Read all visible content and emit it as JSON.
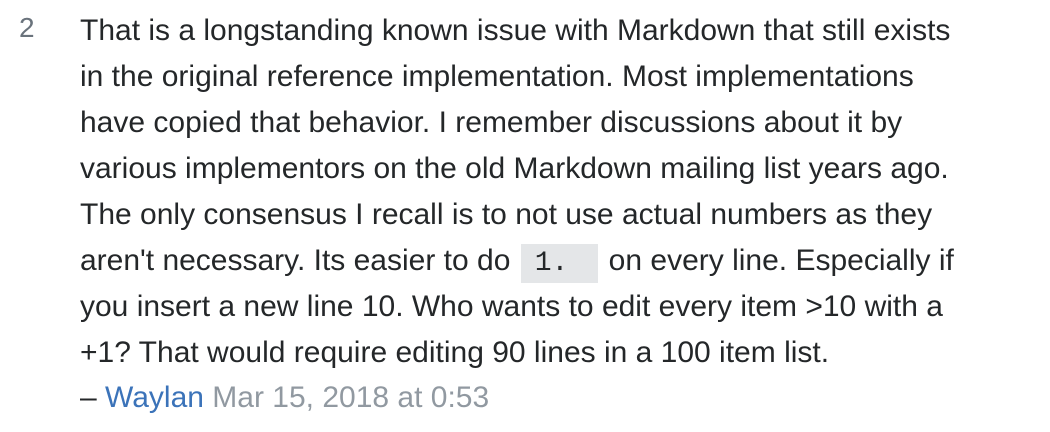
{
  "comment": {
    "score": "2",
    "lines": [
      "That is a longstanding known issue with Markdown that still exists",
      "in the original reference implementation. Most implementations",
      "have copied that behavior. I remember discussions about it by",
      "various implementors on the old Markdown mailing list years ago.",
      "The only consensus I recall is to not use actual numbers as they"
    ],
    "line6_before": "aren't necessary. Its easier to do ",
    "code": "1.",
    "line6_after": " on every line. Especially if",
    "lines_end": [
      "you insert a new line 10. Who wants to edit every item >10 with a",
      "+1? That would require editing 90 lines in a 100 item list."
    ],
    "dash": "– ",
    "author": "Waylan",
    "timestamp": "Mar 15, 2018 at 0:53"
  }
}
